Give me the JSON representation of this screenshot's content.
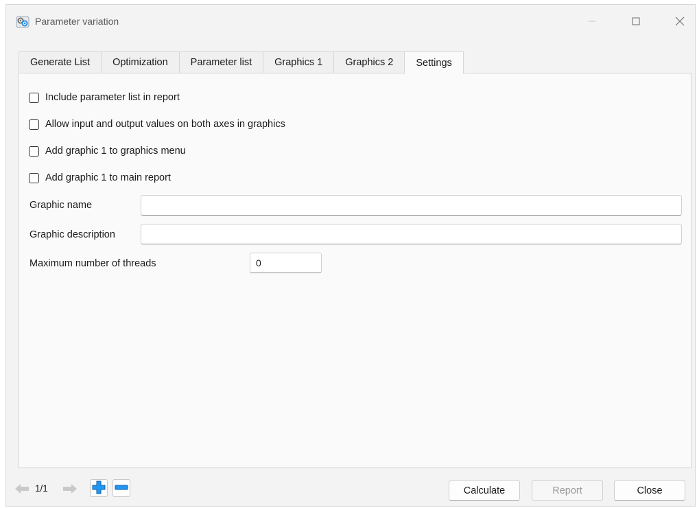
{
  "window": {
    "title": "Parameter variation",
    "icon": "app-gears-icon"
  },
  "tabs": [
    {
      "label": "Generate List",
      "active": false
    },
    {
      "label": "Optimization",
      "active": false
    },
    {
      "label": "Parameter list",
      "active": false
    },
    {
      "label": "Graphics 1",
      "active": false
    },
    {
      "label": "Graphics 2",
      "active": false
    },
    {
      "label": "Settings",
      "active": true
    }
  ],
  "settings": {
    "checkboxes": [
      {
        "label": "Include parameter list in report",
        "checked": false
      },
      {
        "label": "Allow input and output values on both axes in graphics",
        "checked": false
      },
      {
        "label": "Add graphic 1 to graphics menu",
        "checked": false
      },
      {
        "label": "Add graphic 1 to main report",
        "checked": false
      }
    ],
    "graphic_name": {
      "label": "Graphic name",
      "value": ""
    },
    "graphic_description": {
      "label": "Graphic description",
      "value": ""
    },
    "max_threads": {
      "label": "Maximum number of threads",
      "value": "0"
    }
  },
  "footer": {
    "page_indicator": "1/1",
    "buttons": {
      "calculate": "Calculate",
      "report": "Report",
      "close": "Close"
    }
  },
  "colors": {
    "accent_blue": "#1e88e5",
    "disabled_gray": "#9a9a9a"
  }
}
